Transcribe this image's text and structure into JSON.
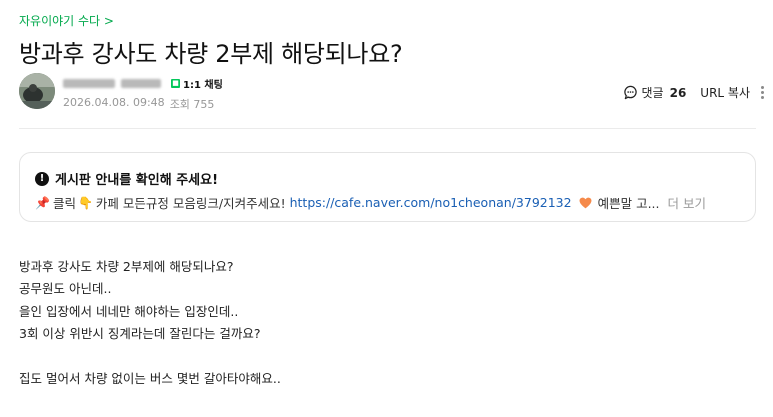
{
  "board": {
    "link_text": "자유이야기 수다 >"
  },
  "post": {
    "title": "방과후 강사도 차량 2부제 해당되나요?",
    "date": "2026.04.08. 09:48",
    "views_label": "조회 755",
    "chat_label": "1:1 채팅"
  },
  "actions": {
    "comment_label": "댓글",
    "comment_count": "26",
    "url_copy": "URL 복사"
  },
  "notice": {
    "heading": "게시판 안내를 확인해 주세요!",
    "text_1": "클릭",
    "text_2": "카페 모든규정 모음링크/지켜주세요!",
    "link": "https://cafe.naver.com/no1cheonan/3792132",
    "text_3": "예쁜말 고...",
    "more": "더 보기"
  },
  "content": {
    "lines": [
      "방과후 강사도 차량 2부제에 해당되나요?",
      "공무원도 아닌데..",
      "을인 입장에서 네네만 해야하는 입장인데..",
      "3회 이상 위반시 징계라는데 잘린다는 걸까요?",
      "",
      "집도 멀어서 차량 없이는 버스 몇번 갈아타야해요.."
    ]
  },
  "colors": {
    "accent": "#03a94d",
    "link": "#1a5fb4",
    "chat_badge": "#03c75a"
  }
}
